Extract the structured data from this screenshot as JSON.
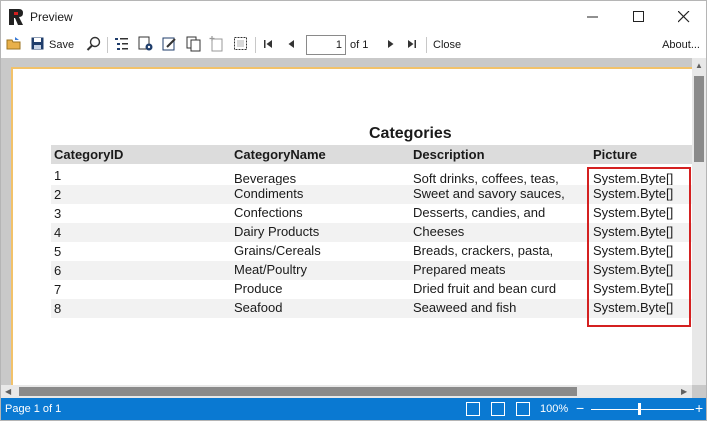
{
  "window": {
    "title": "Preview",
    "app_icon": "fastreport-icon"
  },
  "toolbar": {
    "save_label": "Save",
    "page_value": "1",
    "page_of": "of 1",
    "close_label": "Close",
    "about_label": "About...",
    "icons": [
      "open-icon",
      "save-icon",
      "search-icon",
      "outline-icon",
      "settings-icon",
      "edit-icon",
      "copy-page-icon",
      "new-page-icon",
      "page-setup-icon",
      "first-page-icon",
      "prev-page-icon",
      "next-page-icon",
      "last-page-icon"
    ]
  },
  "report": {
    "title": "Categories",
    "columns": [
      "CategoryID",
      "CategoryName",
      "Description",
      "Picture"
    ],
    "rows": [
      [
        "1",
        "Beverages",
        "Soft drinks, coffees, teas,",
        "System.Byte[]"
      ],
      [
        "2",
        "Condiments",
        "Sweet and savory sauces,",
        "System.Byte[]"
      ],
      [
        "3",
        "Confections",
        "Desserts, candies, and",
        "System.Byte[]"
      ],
      [
        "4",
        "Dairy Products",
        "Cheeses",
        "System.Byte[]"
      ],
      [
        "5",
        "Grains/Cereals",
        "Breads, crackers, pasta,",
        "System.Byte[]"
      ],
      [
        "6",
        "Meat/Poultry",
        "Prepared meats",
        "System.Byte[]"
      ],
      [
        "7",
        "Produce",
        "Dried fruit and bean curd",
        "System.Byte[]"
      ],
      [
        "8",
        "Seafood",
        "Seaweed and fish",
        "System.Byte[]"
      ]
    ],
    "highlight_color": "#d42020"
  },
  "status": {
    "text": "Page 1 of 1",
    "zoom": "100%",
    "zoom_minus": "−",
    "zoom_plus": "+",
    "zoom_level_percent": 100,
    "bar_color": "#0a79d2"
  }
}
